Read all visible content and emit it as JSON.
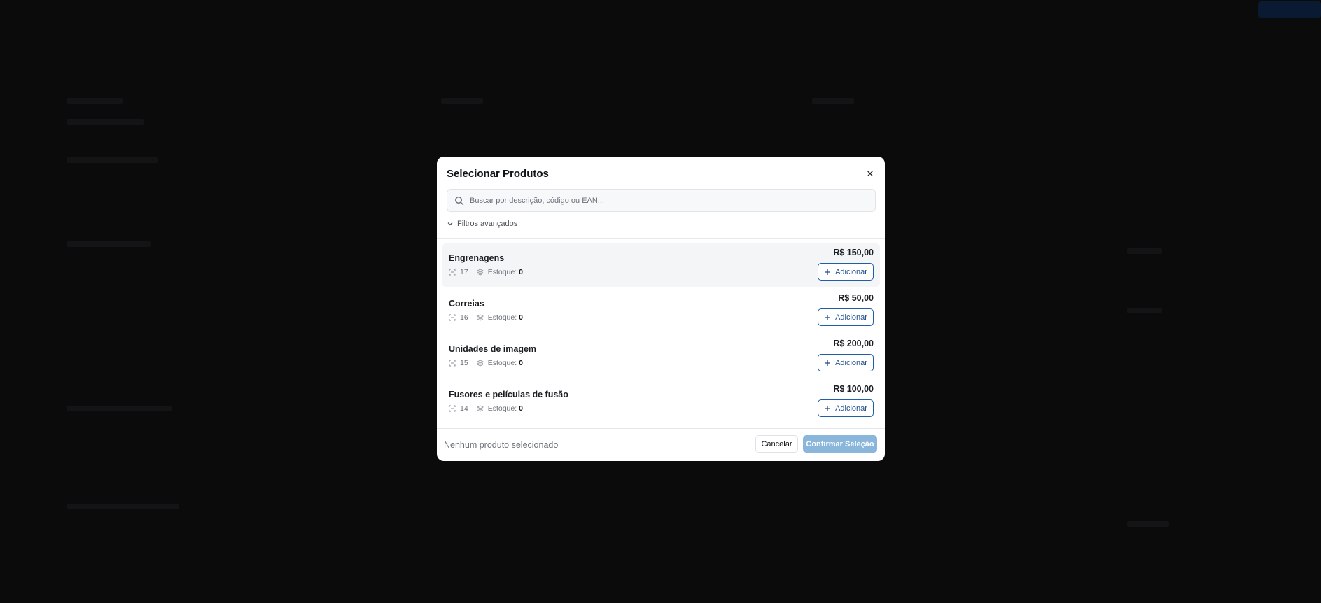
{
  "colors": {
    "primary": "#1f5ea8",
    "confirm_disabled": "#8ab6dc",
    "overlay": "#0b0b0c"
  },
  "modal": {
    "title": "Selecionar Produtos",
    "close_icon": "close-icon",
    "search": {
      "placeholder": "Buscar por descrição, código ou EAN...",
      "value": "",
      "icon": "search-icon"
    },
    "filters_label": "Filtros avançados",
    "add_label": "Adicionar",
    "stock_label": "Estoque:",
    "products": [
      {
        "name": "Engrenagens",
        "code": "17",
        "stock": "0",
        "price": "R$ 150,00"
      },
      {
        "name": "Correias",
        "code": "16",
        "stock": "0",
        "price": "R$ 50,00"
      },
      {
        "name": "Unidades de imagem",
        "code": "15",
        "stock": "0",
        "price": "R$ 200,00"
      },
      {
        "name": "Fusores e películas de fusão",
        "code": "14",
        "stock": "0",
        "price": "R$ 100,00"
      }
    ],
    "footer": {
      "status": "Nenhum produto selecionado",
      "cancel_label": "Cancelar",
      "confirm_label": "Confirmar Seleção"
    }
  }
}
